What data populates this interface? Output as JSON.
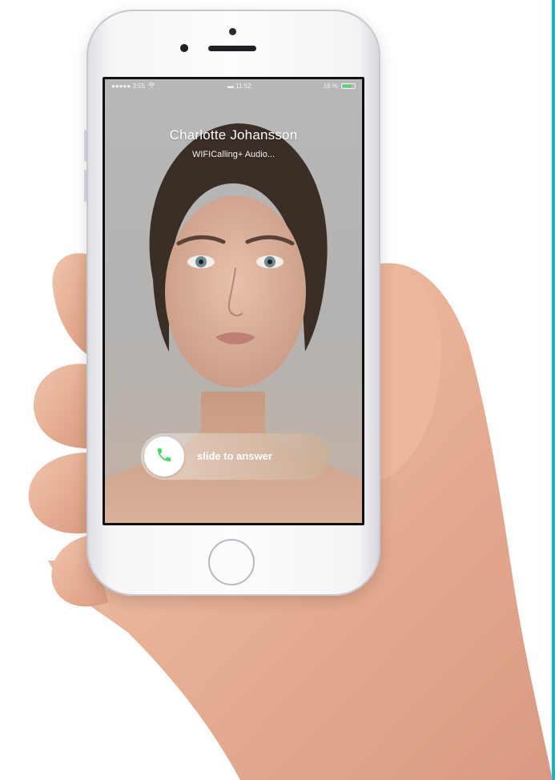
{
  "status_bar": {
    "signal": "●●●●● 3:55",
    "wifi_icon": "wifi-icon",
    "center": "▬ 11:52",
    "battery_text": "16 %",
    "battery_level": 0.8
  },
  "incoming_call": {
    "caller_name": "Charlotte Johansson",
    "subtitle": "WIFICalling+ Audio..."
  },
  "slider": {
    "label": "slide to answer",
    "icon": "phone-icon"
  },
  "colors": {
    "accent_edge": "#12b5c9",
    "answer_green": "#4cd964"
  }
}
